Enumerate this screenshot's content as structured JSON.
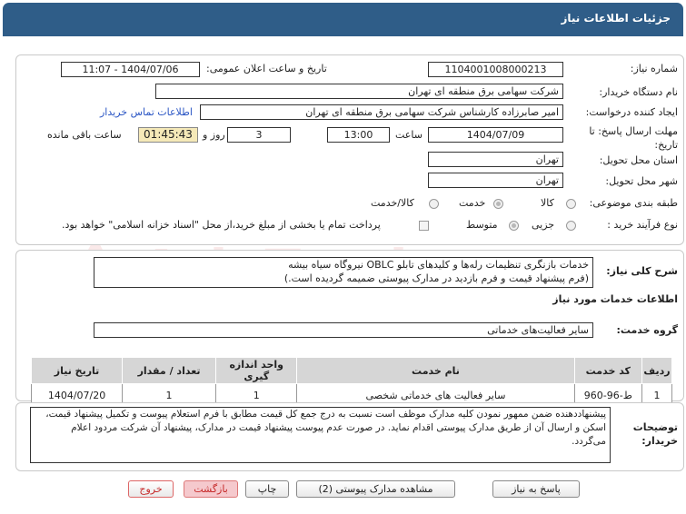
{
  "title": "جزئیات اطلاعات نیاز",
  "fields": {
    "need_number_label": "شماره نیاز:",
    "need_number": "1104001008000213",
    "announce_label": "تاریخ و ساعت اعلان عمومی:",
    "announce_value": "1404/07/06 - 11:07",
    "buyer_label": "نام دستگاه خریدار:",
    "buyer_value": "شرکت سهامی برق منطقه ای تهران",
    "creator_label": "ایجاد کننده درخواست:",
    "creator_value": "امیر صابرزاده کارشناس شرکت سهامی برق منطقه ای تهران",
    "contact_link": "اطلاعات تماس خریدار",
    "deadline_label": "مهلت ارسال پاسخ: تا تاریخ:",
    "deadline_date": "1404/07/09",
    "time_label": "ساعت",
    "deadline_time": "13:00",
    "days_value": "3",
    "days_label": "روز و",
    "remaining_time": "01:45:43",
    "remaining_label": "ساعت باقی مانده",
    "province_label": "استان محل تحویل:",
    "province_value": "تهران",
    "city_label": "شهر محل تحویل:",
    "city_value": "تهران",
    "category_label": "طبقه بندی موضوعی:",
    "category_options": [
      "کالا",
      "خدمت",
      "کالا/خدمت"
    ],
    "process_label": "نوع فرآیند خرید :",
    "process_options": [
      "جزیی",
      "متوسط"
    ],
    "payment_note": "پرداخت تمام یا بخشی از مبلغ خرید،از محل \"اسناد خزانه اسلامی\" خواهد بود."
  },
  "description": {
    "label": "شرح کلی نیاز:",
    "text": "خدمات بازنگری تنظیمات رله‌ها و کلیدهای تابلو OBLC نیروگاه سیاه بیشه\n(فرم پیشنهاد قیمت و فرم بازدید در مدارک پیوستی ضمیمه گردیده است.)"
  },
  "services": {
    "section_title": "اطلاعات خدمات مورد نیاز",
    "group_label": "گروه خدمت:",
    "group_value": "سایر فعالیت‌های خدماتی",
    "headers": [
      "ردیف",
      "کد خدمت",
      "نام خدمت",
      "واحد اندازه گیری",
      "تعداد / مقدار",
      "تاریخ نیاز"
    ],
    "rows": [
      [
        "1",
        "ط-96-960",
        "سایر فعالیت های خدماتی شخصی",
        "1",
        "1",
        "1404/07/20"
      ]
    ]
  },
  "buyer_notes": {
    "label": "توضیحات خریدار:",
    "text": "پیشنهاددهنده ضمن ممهور نمودن کلیه مدارک موظف است نسبت به درج جمع کل قیمت مطابق با فرم استعلام پیوست و تکمیل پیشنهاد قیمت، اسکن و ارسال آن از طریق مدارک پیوستی اقدام نماید. در صورت عدم پیوست پیشنهاد قیمت در مدارک، پیشنهاد آن شرکت مردود اعلام می‌گردد."
  },
  "buttons": {
    "reply": "پاسخ به نیاز",
    "attachments": "مشاهده مدارک پیوستی (2)",
    "print": "چاپ",
    "back": "بازگشت",
    "exit": "خروج"
  },
  "watermark": "AriaTender.net",
  "colors": {
    "title_bar": "#2f5d88",
    "timer_bg": "#f5e9b8",
    "link": "#2a55c4"
  }
}
